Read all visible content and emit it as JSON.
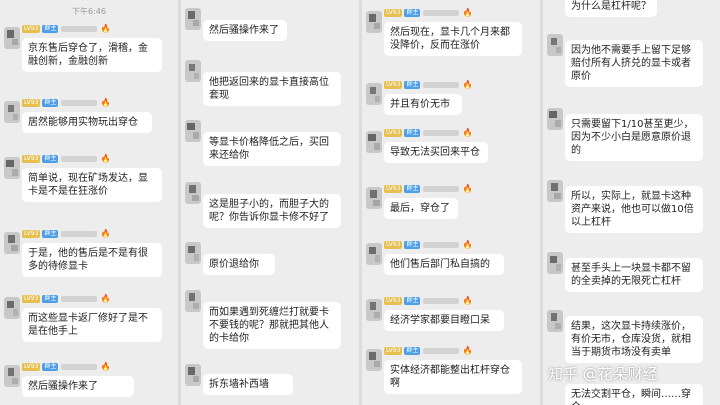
{
  "status_time": "下午6:46",
  "badges": {
    "level": "LV93",
    "role": "群主",
    "crown": "🔥"
  },
  "watermark": "知乎 @花朵财经",
  "columns": [
    {
      "messages": [
        {
          "text": "京东售后穿仓了，滑稽，金融创新，金融创新",
          "sender": true
        },
        {
          "text": "居然能够用实物玩出穿仓",
          "sender": true
        },
        {
          "text": "简单说，现在矿场发达，显卡是不是在狂涨价",
          "sender": true
        },
        {
          "text": "于是，他的售后是不是有很多的待修显卡",
          "sender": true
        },
        {
          "text": "而这些显卡返厂修好了是不是在他手上",
          "sender": true
        },
        {
          "text": "然后骚操作来了",
          "sender": true
        }
      ]
    },
    {
      "messages": [
        {
          "text": "然后骚操作来了",
          "sender": false
        },
        {
          "text": "他把返回来的显卡直接高位套现",
          "sender": false
        },
        {
          "text": "等显卡价格降低之后，买回来还给你",
          "sender": false
        },
        {
          "text": "这是胆子小的，而胆子大的呢？你告诉你显卡修不好了",
          "sender": false
        },
        {
          "text": "原价退给你",
          "sender": false
        },
        {
          "text": "而如果遇到死缠烂打就要卡不要钱的呢？那就把其他人的卡给你",
          "sender": false
        },
        {
          "text": "拆东墙补西墙",
          "sender": false
        }
      ]
    },
    {
      "messages": [
        {
          "text": "然后现在，显卡几个月来都没降价，反而在涨价",
          "sender": true
        },
        {
          "text": "并且有价无市",
          "sender": true
        },
        {
          "text": "导致无法买回来平仓",
          "sender": true
        },
        {
          "text": "最后，穿仓了",
          "sender": true
        },
        {
          "text": "他们售后部门私自搞的",
          "sender": true
        },
        {
          "text": "经济学家都要目瞪口呆",
          "sender": true
        },
        {
          "text": "实体经济都能整出杠杆穿仓啊",
          "sender": true
        }
      ]
    },
    {
      "messages": [
        {
          "text": "为什么是杠杆呢？",
          "sender": false
        },
        {
          "text": "因为他不需要手上留下足够赔付所有人挤兑的显卡或者原价",
          "sender": false
        },
        {
          "text": "只需要留下1/10甚至更少，因为不少小白是愿意原价退的",
          "sender": false
        },
        {
          "text": "所以，实际上，就显卡这种资产来说，他也可以做10倍以上杠杆",
          "sender": false
        },
        {
          "text": "甚至手头上一块显卡都不留的全卖掉的无限死亡杠杆",
          "sender": false
        },
        {
          "text": "结果，这次显卡持续涨价，有价无市，仓库没货，就相当于期货市场没有卖单",
          "sender": false
        },
        {
          "text": "无法交割平仓，瞬间……穿仓",
          "sender": false
        }
      ]
    }
  ]
}
